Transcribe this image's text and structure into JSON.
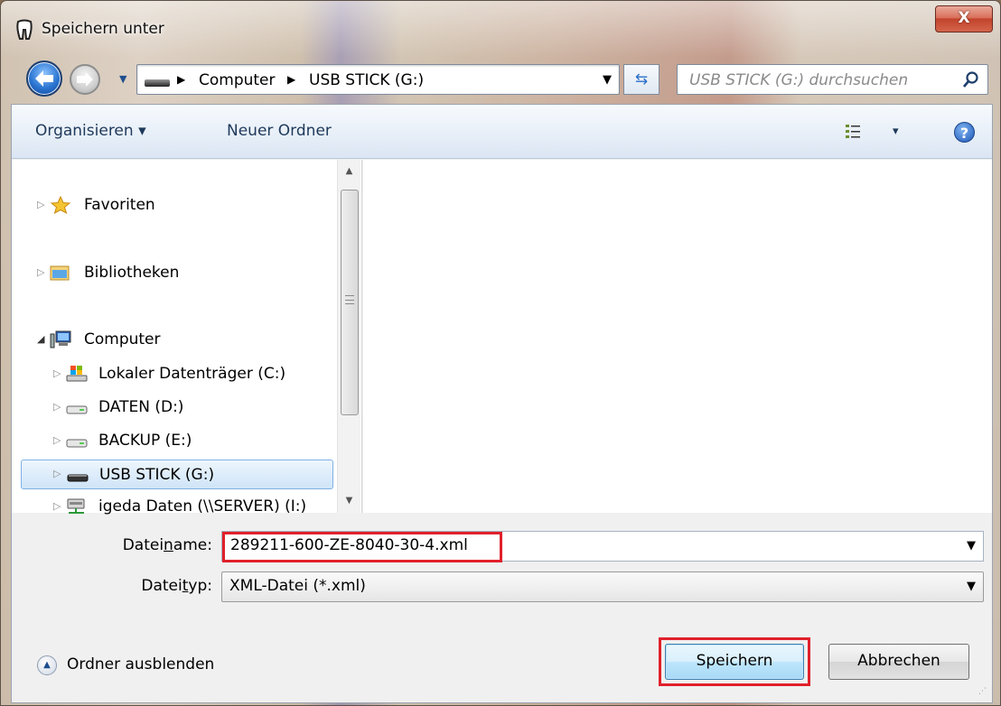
{
  "window": {
    "title": "Speichern unter",
    "close_label": "X"
  },
  "navigation": {
    "breadcrumb": [
      "Computer",
      "USB STICK (G:)"
    ],
    "search_placeholder": "USB STICK (G:) durchsuchen"
  },
  "toolbar": {
    "organize_label": "Organisieren ▾",
    "new_folder_label": "Neuer Ordner",
    "view_dropdown": "▾",
    "help": "?"
  },
  "tree": {
    "favorites": "Favoriten",
    "libraries": "Bibliotheken",
    "computer": "Computer",
    "drives": [
      {
        "label": "Lokaler Datenträger (C:)",
        "icon": "system-drive-icon"
      },
      {
        "label": "DATEN (D:)",
        "icon": "hard-drive-icon"
      },
      {
        "label": "BACKUP (E:)",
        "icon": "hard-drive-icon"
      },
      {
        "label": "USB STICK (G:)",
        "icon": "usb-drive-icon",
        "selected": true
      },
      {
        "label": "igeda Daten (\\\\SERVER) (I:)",
        "icon": "network-drive-icon"
      }
    ]
  },
  "form": {
    "filename_label_pre": "Datei",
    "filename_label_accel": "n",
    "filename_label_post": "ame:",
    "filename_value": "289211-600-ZE-8040-30-4.xml",
    "filetype_label_pre": "Datei",
    "filetype_label_accel": "t",
    "filetype_label_post": "yp:",
    "filetype_value": "XML-Datei (*.xml)"
  },
  "footer": {
    "hide_folders": "Ordner ausblenden",
    "save": "Speichern",
    "cancel": "Abbrechen"
  },
  "colors": {
    "highlight_red": "#e0202b",
    "selection_blue": "#cfe4f8"
  }
}
